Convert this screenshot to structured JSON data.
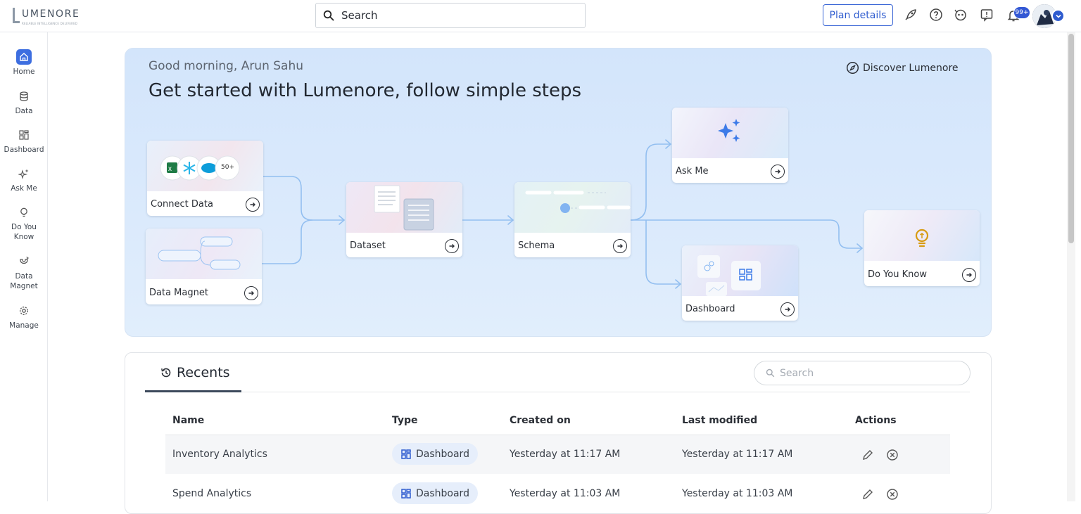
{
  "brand": {
    "name": "UMENORE",
    "tagline": "RELIABLE INTELLIGENCE DELIVERED"
  },
  "topbar": {
    "search_text": "Search",
    "plan_label": "Plan details",
    "notification_count": "99+",
    "icons": [
      "rocket-icon",
      "help-icon",
      "bot-icon",
      "feedback-icon",
      "bell-icon",
      "avatar"
    ]
  },
  "sidebar": {
    "items": [
      {
        "label": "Home",
        "icon": "home-icon",
        "active": true
      },
      {
        "label": "Data",
        "icon": "database-icon"
      },
      {
        "label": "Dashboard",
        "icon": "dashboard-icon"
      },
      {
        "label": "Ask Me",
        "icon": "sparkle-icon"
      },
      {
        "label": "Do You Know",
        "icon": "bulb-icon"
      },
      {
        "label": "Data Magnet",
        "icon": "magnet-icon"
      },
      {
        "label": "Manage",
        "icon": "gear-icon"
      }
    ]
  },
  "hero": {
    "greeting": "Good morning, Arun Sahu",
    "title": "Get started with Lumenore, follow simple steps",
    "discover": "Discover Lumenore",
    "connectors_more": "50+",
    "cards": {
      "connect_data": "Connect Data",
      "data_magnet": "Data Magnet",
      "dataset": "Dataset",
      "schema": "Schema",
      "ask_me": "Ask Me",
      "dashboard": "Dashboard",
      "do_you_know": "Do You Know"
    }
  },
  "recents": {
    "title": "Recents",
    "search_placeholder": "Search",
    "columns": [
      "Name",
      "Type",
      "Created on",
      "Last modified",
      "Actions"
    ],
    "rows": [
      {
        "name": "Inventory Analytics",
        "type": "Dashboard",
        "created": "Yesterday at 11:17 AM",
        "modified": "Yesterday at 11:17 AM"
      },
      {
        "name": "Spend Analytics",
        "type": "Dashboard",
        "created": "Yesterday at 11:03 AM",
        "modified": "Yesterday at 11:03 AM"
      }
    ]
  },
  "colors": {
    "accent": "#3d6ee0",
    "hero_bg": "#d8e8fb",
    "plan_border": "#3a66d6",
    "bulb": "#d79b12"
  }
}
